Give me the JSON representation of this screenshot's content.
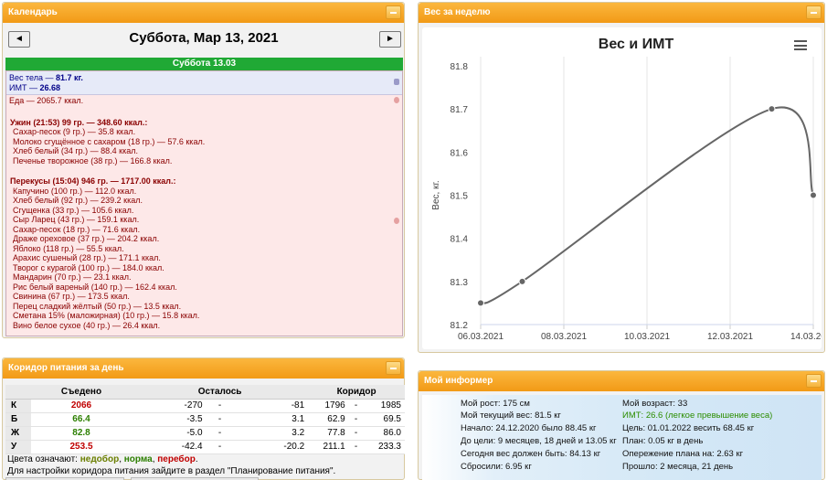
{
  "calendar": {
    "header": "Календарь",
    "date_title": "Суббота, Мар 13, 2021",
    "day_label": "Суббота 13.03",
    "weight_line": {
      "prefix": "Вес тела — ",
      "value": "81.7 кг."
    },
    "bmi_line": {
      "prefix": "ИМТ — ",
      "value": "26.68"
    },
    "food_total": {
      "prefix": "Еда — ",
      "value": "2065.7 ккал."
    },
    "meals": [
      {
        "title": "Ужин (21:53) 99 гр. — 348.60 ккал.:",
        "items": [
          "Сахар-песок (9 гр.) — 35.8 ккал.",
          "Молоко сгущённое с сахаром (18 гр.) — 57.6 ккал.",
          "Хлеб белый (34 гр.) — 88.4 ккал.",
          "Печенье творожное (38 гр.) — 166.8 ккал."
        ]
      },
      {
        "title": "Перекусы (15:04) 946 гр. — 1717.00 ккал.:",
        "items": [
          "Капучино (100 гр.) — 112.0 ккал.",
          "Хлеб белый (92 гр.) — 239.2 ккал.",
          "Сгущенка (33 гр.) — 105.6 ккал.",
          "Сыр Ларец (43 гр.) — 159.1 ккал.",
          "Сахар-песок (18 гр.) — 71.6 ккал.",
          "Драже ореховое (37 гр.) — 204.2 ккал.",
          "Яблоко (118 гр.) — 55.5 ккал.",
          "Арахис сушеный (28 гр.) — 171.1 ккал.",
          "Творог с курагой (100 гр.) — 184.0 ккал.",
          "Мандарин (70 гр.) — 23.1 ккал.",
          "Рис белый вареный (140 гр.) — 162.4 ккал.",
          "Свинина (67 гр.) — 173.5 ккал.",
          "Перец сладкий жёлтый (50 гр.) — 13.5 ккал.",
          "Сметана 15% (маложирная) (10 гр.) — 15.8 ккал.",
          "Вино белое сухое (40 гр.) — 26.4 ккал."
        ]
      }
    ],
    "prev_icon": "arrow-left-icon",
    "next_icon": "arrow-right-icon"
  },
  "weekly": {
    "header": "Вес за неделю",
    "menu_icon": "hamburger-menu-icon"
  },
  "chart_data": {
    "type": "line",
    "title": "Вес и ИМТ",
    "ylabel": "Вес, кг.",
    "xlabel": "",
    "ylim": [
      81.2,
      81.8
    ],
    "yticks": [
      "81.8",
      "81.7",
      "81.6",
      "81.5",
      "81.4",
      "81.3",
      "81.2"
    ],
    "xticks": [
      "06.03.2021",
      "08.03.2021",
      "10.03.2021",
      "12.03.2021",
      "14.03.2021"
    ],
    "xlim": [
      "2021-03-06",
      "2021-03-14"
    ],
    "series": [
      {
        "points": [
          {
            "x": "2021-03-06",
            "y": 81.25
          },
          {
            "x": "2021-03-07",
            "y": 81.3
          },
          {
            "x": "2021-03-13",
            "y": 81.7
          },
          {
            "x": "2021-03-14",
            "y": 81.5
          }
        ],
        "color": "#666666"
      }
    ],
    "grid": "vertical",
    "legend": "none"
  },
  "corridor": {
    "header": "Коридор питания за день",
    "columns": [
      "Съедено",
      "Осталось",
      "Коридор"
    ],
    "rows": [
      {
        "label": "К",
        "eaten": "2066",
        "eaten_status": "over",
        "left_from": "-270",
        "left_to": "-81",
        "cor_from": "1796",
        "cor_to": "1985"
      },
      {
        "label": "Б",
        "eaten": "66.4",
        "eaten_status": "norm",
        "left_from": "-3.5",
        "left_to": "3.1",
        "cor_from": "62.9",
        "cor_to": "69.5"
      },
      {
        "label": "Ж",
        "eaten": "82.8",
        "eaten_status": "norm",
        "left_from": "-5.0",
        "left_to": "3.2",
        "cor_from": "77.8",
        "cor_to": "86.0"
      },
      {
        "label": "У",
        "eaten": "253.5",
        "eaten_status": "over",
        "left_from": "-42.4",
        "left_to": "-20.2",
        "cor_from": "211.1",
        "cor_to": "233.3"
      }
    ],
    "dash": "-",
    "legend": {
      "prefix": "Цвета означают: ",
      "under": "недобор",
      "sep1": ", ",
      "norm": "норма",
      "sep2": ", ",
      "over": "перебор",
      "suffix": "."
    },
    "hint": "Для настройки коридора питания зайдите в раздел \"Планирование питания\"."
  },
  "informer": {
    "header": "Мой информер",
    "left": [
      "Мой рост: 175 см",
      "Мой текущий вес: 81.5 кг",
      "Начало: 24.12.2020 было 88.45 кг",
      "До цели: 9 месяцев, 18 дней и 13.05 кг",
      "Сегодня вес должен быть: 84.13 кг",
      "Сбросили: 6.95 кг"
    ],
    "right": [
      "Мой возраст: 33",
      "ИМТ: 26.6 (легкое превышение веса)",
      "Цель: 01.01.2022 весить 68.45 кг",
      "План: 0.05 кг в день",
      "Опережение плана на: 2.63 кг",
      "Прошло: 2 месяца, 21 день"
    ],
    "colors": {
      "accent_green": "#2c8d00"
    }
  },
  "colors": {
    "header_orange": "#f29a16",
    "day_green": "#20a935",
    "over_red": "#c00000",
    "norm_green": "#2c7f00",
    "under_olive": "#6b7f00"
  }
}
